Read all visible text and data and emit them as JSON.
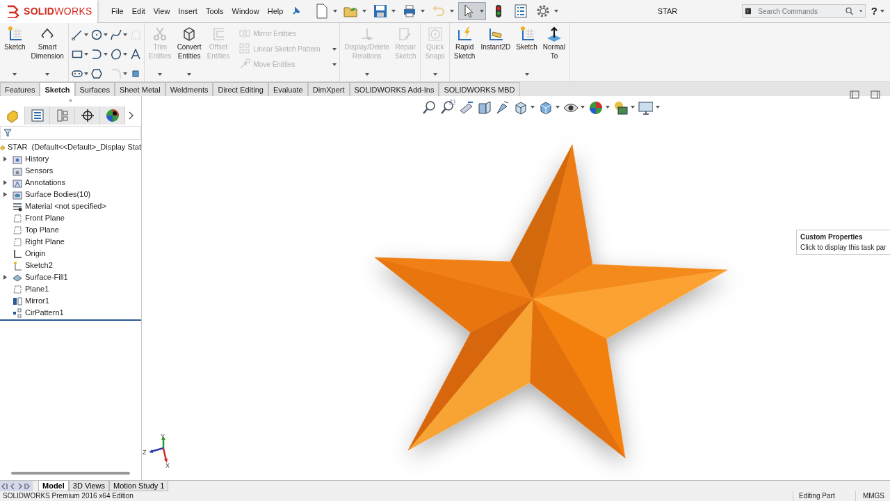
{
  "app": {
    "logo": "**SOLID**WORKS",
    "menu": [
      "File",
      "Edit",
      "View",
      "Insert",
      "Tools",
      "Window",
      "Help"
    ],
    "quick_access": [
      {
        "dropdown": true,
        "disabled": false,
        "selected": false
      },
      {
        "dropdown": true,
        "disabled": false,
        "selected": false
      },
      {
        "dropdown": true,
        "disabled": false,
        "selected": false
      },
      {
        "dropdown": true,
        "disabled": false,
        "selected": false
      },
      {
        "dropdown": true,
        "disabled": true,
        "selected": false
      },
      {
        "dropdown": true,
        "disabled": false,
        "selected": true
      },
      {
        "dropdown": false,
        "disabled": false,
        "selected": false
      },
      {
        "dropdown": false,
        "disabled": false,
        "selected": false
      },
      {
        "dropdown": true,
        "disabled": false,
        "selected": false
      }
    ],
    "document_title": "STAR",
    "search": {
      "placeholder": "Search Commands"
    },
    "help": "?"
  },
  "ribbon": {
    "groups": [
      {
        "items": [
          {
            "kind": "large",
            "label": "Sketch",
            "disabled": false,
            "dropdown": true
          },
          {
            "kind": "large",
            "label": "Smart Dimension",
            "disabled": false,
            "dropdown": true
          }
        ]
      },
      {
        "items": [
          {
            "kind": "icon",
            "disabled": false,
            "dropdown": true
          },
          {
            "kind": "icon",
            "disabled": false,
            "dropdown": true
          },
          {
            "kind": "icon",
            "disabled": false,
            "dropdown": true
          },
          {
            "kind": "icon",
            "disabled": true,
            "dropdown": false
          },
          {
            "kind": "icon",
            "disabled": false,
            "dropdown": true
          },
          {
            "kind": "icon",
            "disabled": false,
            "dropdown": true
          },
          {
            "kind": "icon",
            "disabled": false,
            "dropdown": true
          },
          {
            "kind": "icon",
            "disabled": false,
            "dropdown": false
          },
          {
            "kind": "icon",
            "disabled": false,
            "dropdown": true
          },
          {
            "kind": "icon",
            "disabled": false,
            "dropdown": false
          },
          {
            "kind": "icon",
            "disabled": true,
            "dropdown": true
          },
          {
            "kind": "icon",
            "disabled": false,
            "dropdown": false
          }
        ]
      },
      {
        "items": [
          {
            "kind": "large",
            "label": "Trim Entities",
            "disabled": true,
            "dropdown": true
          },
          {
            "kind": "large",
            "label": "Convert Entities",
            "disabled": false,
            "dropdown": true
          },
          {
            "kind": "large",
            "label": "Offset Entities",
            "disabled": true,
            "dropdown": false
          },
          {
            "kind": "stack",
            "rows": [
              {
                "label": "Mirror Entities",
                "disabled": true,
                "dropdown": false
              },
              {
                "label": "Linear Sketch Pattern",
                "disabled": true,
                "dropdown": true
              },
              {
                "label": "Move Entities",
                "disabled": true,
                "dropdown": true
              }
            ]
          }
        ]
      },
      {
        "items": [
          {
            "kind": "large",
            "label": "Display/Delete Relations",
            "disabled": true,
            "dropdown": true
          },
          {
            "kind": "large",
            "label": "Repair Sketch",
            "disabled": true,
            "dropdown": false
          }
        ]
      },
      {
        "items": [
          {
            "kind": "large",
            "label": "Quick Snaps",
            "disabled": true,
            "dropdown": true
          }
        ]
      },
      {
        "items": [
          {
            "kind": "large",
            "label": "Rapid Sketch",
            "disabled": false,
            "dropdown": false
          },
          {
            "kind": "large",
            "label": "Instant2D",
            "disabled": false,
            "dropdown": false
          },
          {
            "kind": "large",
            "label": "Sketch",
            "disabled": false,
            "dropdown": true
          },
          {
            "kind": "large",
            "label": "Normal To",
            "disabled": false,
            "dropdown": false
          }
        ]
      }
    ]
  },
  "command_tabs": [
    {
      "label": "Features",
      "selected": false
    },
    {
      "label": "Sketch",
      "selected": true
    },
    {
      "label": "Surfaces",
      "selected": false
    },
    {
      "label": "Sheet Metal",
      "selected": false
    },
    {
      "label": "Weldments",
      "selected": false
    },
    {
      "label": "Direct Editing",
      "selected": false
    },
    {
      "label": "Evaluate",
      "selected": false
    },
    {
      "label": "DimXpert",
      "selected": false
    },
    {
      "label": "SOLIDWORKS Add-Ins",
      "selected": false
    },
    {
      "label": "SOLIDWORKS MBD",
      "selected": false
    }
  ],
  "feature_manager": {
    "panel_tabs": [
      {
        "selected": true
      },
      {
        "selected": false
      },
      {
        "selected": false
      },
      {
        "selected": false
      },
      {
        "selected": false
      }
    ],
    "root": "STAR  (Default<<Default>_Display Stat",
    "items": [
      {
        "label": "History",
        "expandable": true
      },
      {
        "label": "Sensors",
        "expandable": false
      },
      {
        "label": "Annotations",
        "expandable": true
      },
      {
        "label": "Surface Bodies(10)",
        "expandable": true
      },
      {
        "label": "Material <not specified>",
        "expandable": false
      },
      {
        "label": "Front Plane",
        "expandable": false
      },
      {
        "label": "Top Plane",
        "expandable": false
      },
      {
        "label": "Right Plane",
        "expandable": false
      },
      {
        "label": "Origin",
        "expandable": false
      },
      {
        "label": "Sketch2",
        "expandable": false
      },
      {
        "label": "Surface-Fill1",
        "expandable": true
      },
      {
        "label": "Plane1",
        "expandable": false
      },
      {
        "label": "Mirror1",
        "expandable": false
      },
      {
        "label": "CirPattern1",
        "expandable": false
      }
    ]
  },
  "viewport": {
    "task_tooltip": {
      "title": "Custom Properties",
      "text": "Click to display this task par"
    },
    "triad": {
      "y": "Y",
      "z": "Z",
      "x": "X"
    }
  },
  "bottom_tabs": [
    {
      "label": "Model",
      "selected": true
    },
    {
      "label": "3D Views",
      "selected": false
    },
    {
      "label": "Motion Study 1",
      "selected": false
    }
  ],
  "status_bar": {
    "edition": "SOLIDWORKS Premium 2016 x64 Edition",
    "mode": "Editing Part",
    "units": "MMGS"
  }
}
